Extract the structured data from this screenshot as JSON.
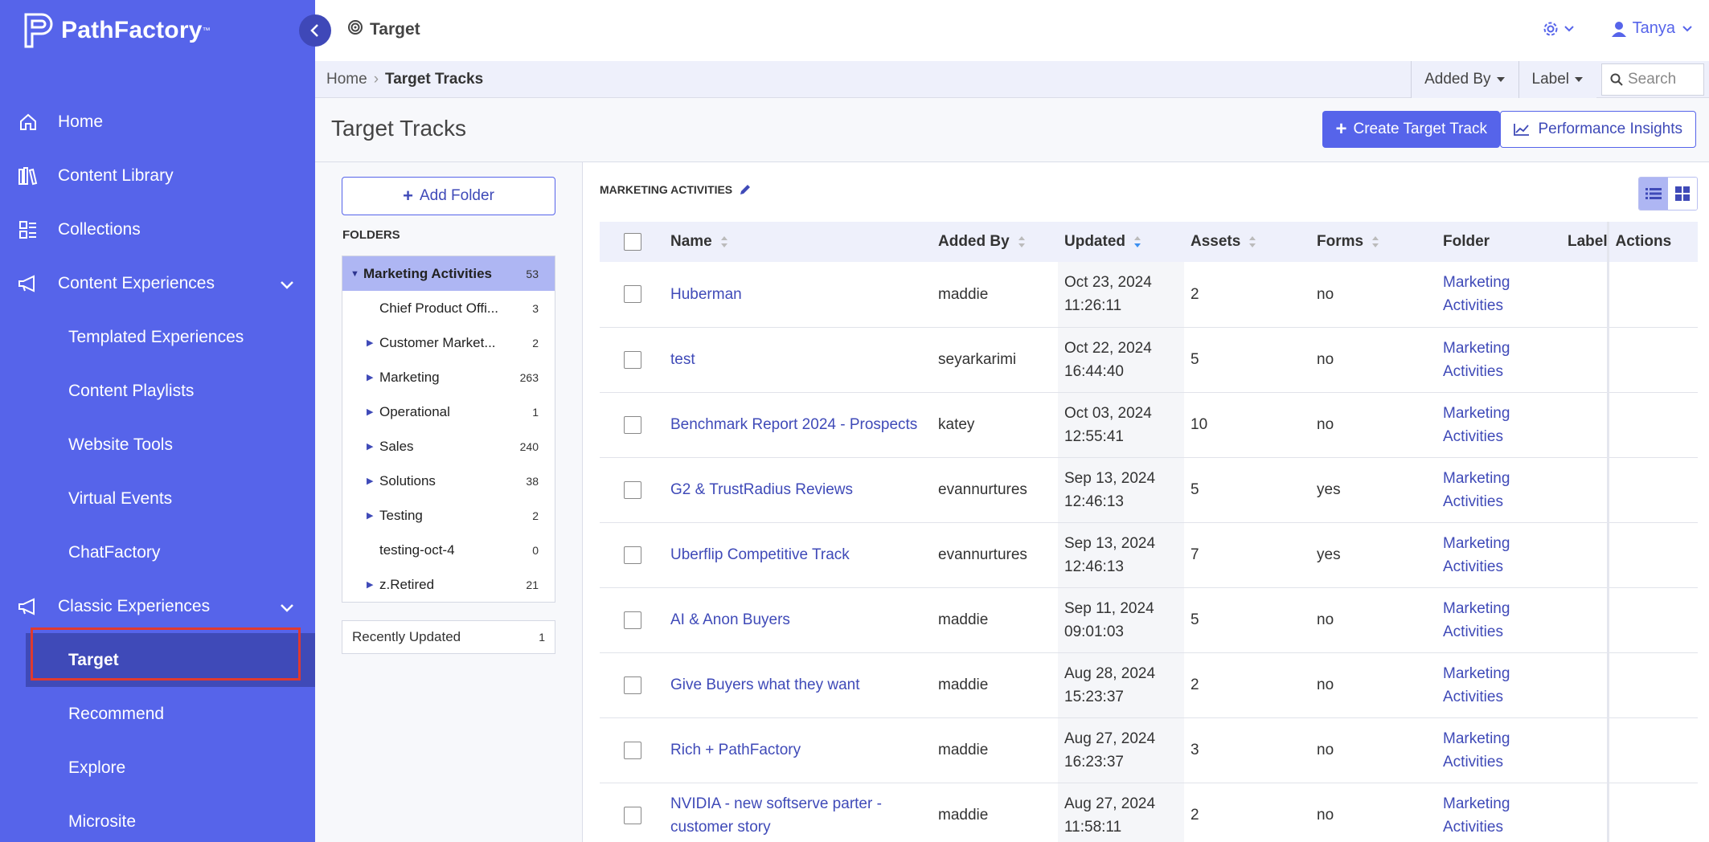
{
  "brand": {
    "name": "PathFactory",
    "accent": "#5664ea",
    "sidebar_active": "#3f4ab8"
  },
  "sidebar": {
    "items": [
      {
        "label": "Home",
        "icon": "home-icon"
      },
      {
        "label": "Content Library",
        "icon": "library-icon"
      },
      {
        "label": "Collections",
        "icon": "collections-icon"
      },
      {
        "label": "Content Experiences",
        "icon": "megaphone-icon"
      },
      {
        "label": "Templated Experiences"
      },
      {
        "label": "Content Playlists"
      },
      {
        "label": "Website Tools"
      },
      {
        "label": "Virtual Events"
      },
      {
        "label": "ChatFactory"
      },
      {
        "label": "Classic Experiences",
        "icon": "megaphone-icon"
      },
      {
        "label": "Target",
        "active": true
      },
      {
        "label": "Recommend"
      },
      {
        "label": "Explore"
      },
      {
        "label": "Microsite"
      }
    ]
  },
  "header": {
    "title": "Target",
    "user": "Tanya"
  },
  "breadcrumb": {
    "home": "Home",
    "current": "Target Tracks"
  },
  "filters": {
    "added_by": "Added By",
    "label": "Label",
    "search_placeholder": "Search"
  },
  "page": {
    "title": "Target Tracks",
    "create_button": "Create Target Track",
    "insights_button": "Performance Insights"
  },
  "folders": {
    "add_button": "Add Folder",
    "heading": "FOLDERS",
    "items": [
      {
        "name": "Marketing Activities",
        "count": "53"
      },
      {
        "name": "Chief Product Offi...",
        "count": "3"
      },
      {
        "name": "Customer Market...",
        "count": "2"
      },
      {
        "name": "Marketing",
        "count": "263"
      },
      {
        "name": "Operational",
        "count": "1"
      },
      {
        "name": "Sales",
        "count": "240"
      },
      {
        "name": "Solutions",
        "count": "38"
      },
      {
        "name": "Testing",
        "count": "2"
      },
      {
        "name": "testing-oct-4",
        "count": "0"
      },
      {
        "name": "z.Retired",
        "count": "21"
      }
    ],
    "recent": {
      "name": "Recently Updated",
      "count": "1"
    }
  },
  "table": {
    "folder_heading": "MARKETING ACTIVITIES",
    "columns": [
      "Name",
      "Added By",
      "Updated",
      "Assets",
      "Forms",
      "Folder",
      "Label",
      "Actions"
    ],
    "rows": [
      {
        "name": "Huberman",
        "added_by": "maddie",
        "date": "Oct 23, 2024",
        "time": "11:26:11",
        "assets": "2",
        "forms": "no",
        "folder1": "Marketing",
        "folder2": "Activities"
      },
      {
        "name": "test",
        "added_by": "seyarkarimi",
        "date": "Oct 22, 2024",
        "time": "16:44:40",
        "assets": "5",
        "forms": "no",
        "folder1": "Marketing",
        "folder2": "Activities"
      },
      {
        "name": "Benchmark Report 2024 - Prospects",
        "added_by": "katey",
        "date": "Oct 03, 2024",
        "time": "12:55:41",
        "assets": "10",
        "forms": "no",
        "folder1": "Marketing",
        "folder2": "Activities"
      },
      {
        "name": "G2 & TrustRadius Reviews",
        "added_by": "evannurtures",
        "date": "Sep 13, 2024",
        "time": "12:46:13",
        "assets": "5",
        "forms": "yes",
        "folder1": "Marketing",
        "folder2": "Activities"
      },
      {
        "name": "Uberflip Competitive Track",
        "added_by": "evannurtures",
        "date": "Sep 13, 2024",
        "time": "12:46:13",
        "assets": "7",
        "forms": "yes",
        "folder1": "Marketing",
        "folder2": "Activities"
      },
      {
        "name": "AI & Anon Buyers",
        "added_by": "maddie",
        "date": "Sep 11, 2024",
        "time": "09:01:03",
        "assets": "5",
        "forms": "no",
        "folder1": "Marketing",
        "folder2": "Activities"
      },
      {
        "name": "Give Buyers what they want",
        "added_by": "maddie",
        "date": "Aug 28, 2024",
        "time": "15:23:37",
        "assets": "2",
        "forms": "no",
        "folder1": "Marketing",
        "folder2": "Activities"
      },
      {
        "name": "Rich + PathFactory",
        "added_by": "maddie",
        "date": "Aug 27, 2024",
        "time": "16:23:37",
        "assets": "3",
        "forms": "no",
        "folder1": "Marketing",
        "folder2": "Activities"
      },
      {
        "name": "NVIDIA - new softserve parter - customer story",
        "added_by": "maddie",
        "date": "Aug 27, 2024",
        "time": "11:58:11",
        "assets": "2",
        "forms": "no",
        "folder1": "Marketing",
        "folder2": "Activities"
      }
    ]
  }
}
